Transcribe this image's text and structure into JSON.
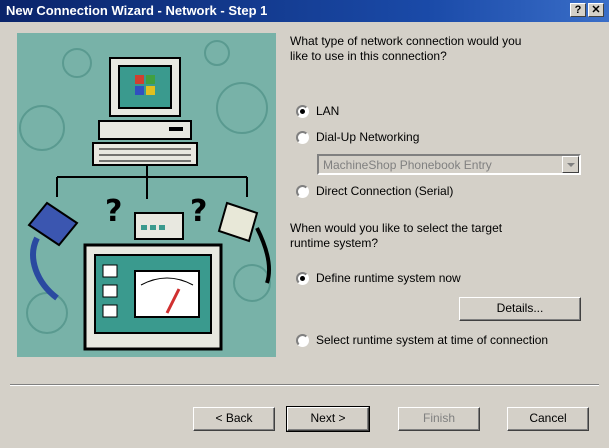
{
  "window": {
    "title": "New Connection Wizard - Network - Step 1",
    "help_label": "?",
    "close_label": "✕"
  },
  "question1": {
    "line1": "What type of network connection would you",
    "line2": "like to use in this connection?"
  },
  "connection_options": [
    {
      "label": "LAN",
      "checked": true
    },
    {
      "label": "Dial-Up Networking",
      "checked": false
    },
    {
      "label": "Direct Connection (Serial)",
      "checked": false
    }
  ],
  "phonebook": {
    "value": "MachineShop Phonebook Entry",
    "enabled": false
  },
  "question2": {
    "line1": "When would you like to select the target",
    "line2": "runtime system?"
  },
  "runtime_options": [
    {
      "label": "Define runtime system now",
      "checked": true
    },
    {
      "label": "Select runtime system at time of connection",
      "checked": false
    }
  ],
  "buttons": {
    "details": "Details...",
    "back": "< Back",
    "next": "Next >",
    "finish": "Finish",
    "cancel": "Cancel"
  },
  "colors": {
    "titlebar": "#0a246a",
    "dialog": "#d4d0c8",
    "illustration_bg": "#78b2a8"
  }
}
